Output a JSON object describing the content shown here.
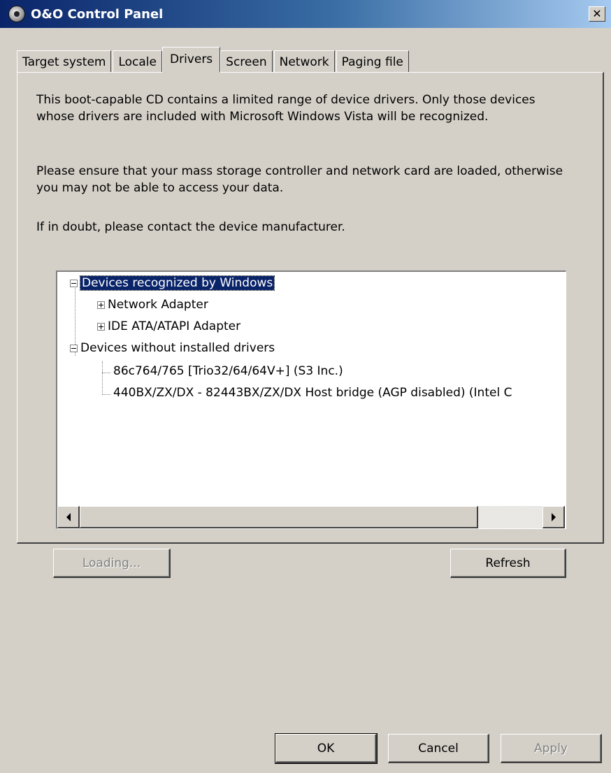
{
  "window": {
    "title": "O&O Control Panel",
    "close_symbol": "✕"
  },
  "tabs": [
    {
      "label": "Target system",
      "active": false
    },
    {
      "label": "Locale",
      "active": false
    },
    {
      "label": "Drivers",
      "active": true
    },
    {
      "label": "Screen",
      "active": false
    },
    {
      "label": "Network",
      "active": false
    },
    {
      "label": "Paging file",
      "active": false
    }
  ],
  "drivers": {
    "paragraphs": [
      "This boot-capable CD contains a limited range of device drivers. Only those devices whose drivers are included with Microsoft Windows Vista will be recognized.",
      "Please ensure that your mass storage controller and network card are loaded, otherwise you may not be able to access your data.",
      "If in doubt, please contact the device manufacturer."
    ],
    "tree": {
      "recognized": {
        "label": "Devices recognized by Windows",
        "children": [
          "Network Adapter",
          "IDE ATA/ATAPI Adapter"
        ]
      },
      "unrecognized": {
        "label": "Devices without installed drivers",
        "children": [
          "86c764/765 [Trio32/64/64V+] (S3 Inc.)",
          "440BX/ZX/DX - 82443BX/ZX/DX Host bridge (AGP disabled) (Intel C"
        ]
      }
    },
    "loading_button": "Loading...",
    "refresh_button": "Refresh"
  },
  "footer": {
    "ok": "OK",
    "cancel": "Cancel",
    "apply": "Apply"
  },
  "colors": {
    "dialog_bg": "#d4d0c8",
    "selection": "#0a246a",
    "title_gradient_start": "#0a246a"
  },
  "icons": [
    "app-icon",
    "close-icon",
    "expand-icon",
    "collapse-icon",
    "scroll-left-icon",
    "scroll-right-icon"
  ]
}
